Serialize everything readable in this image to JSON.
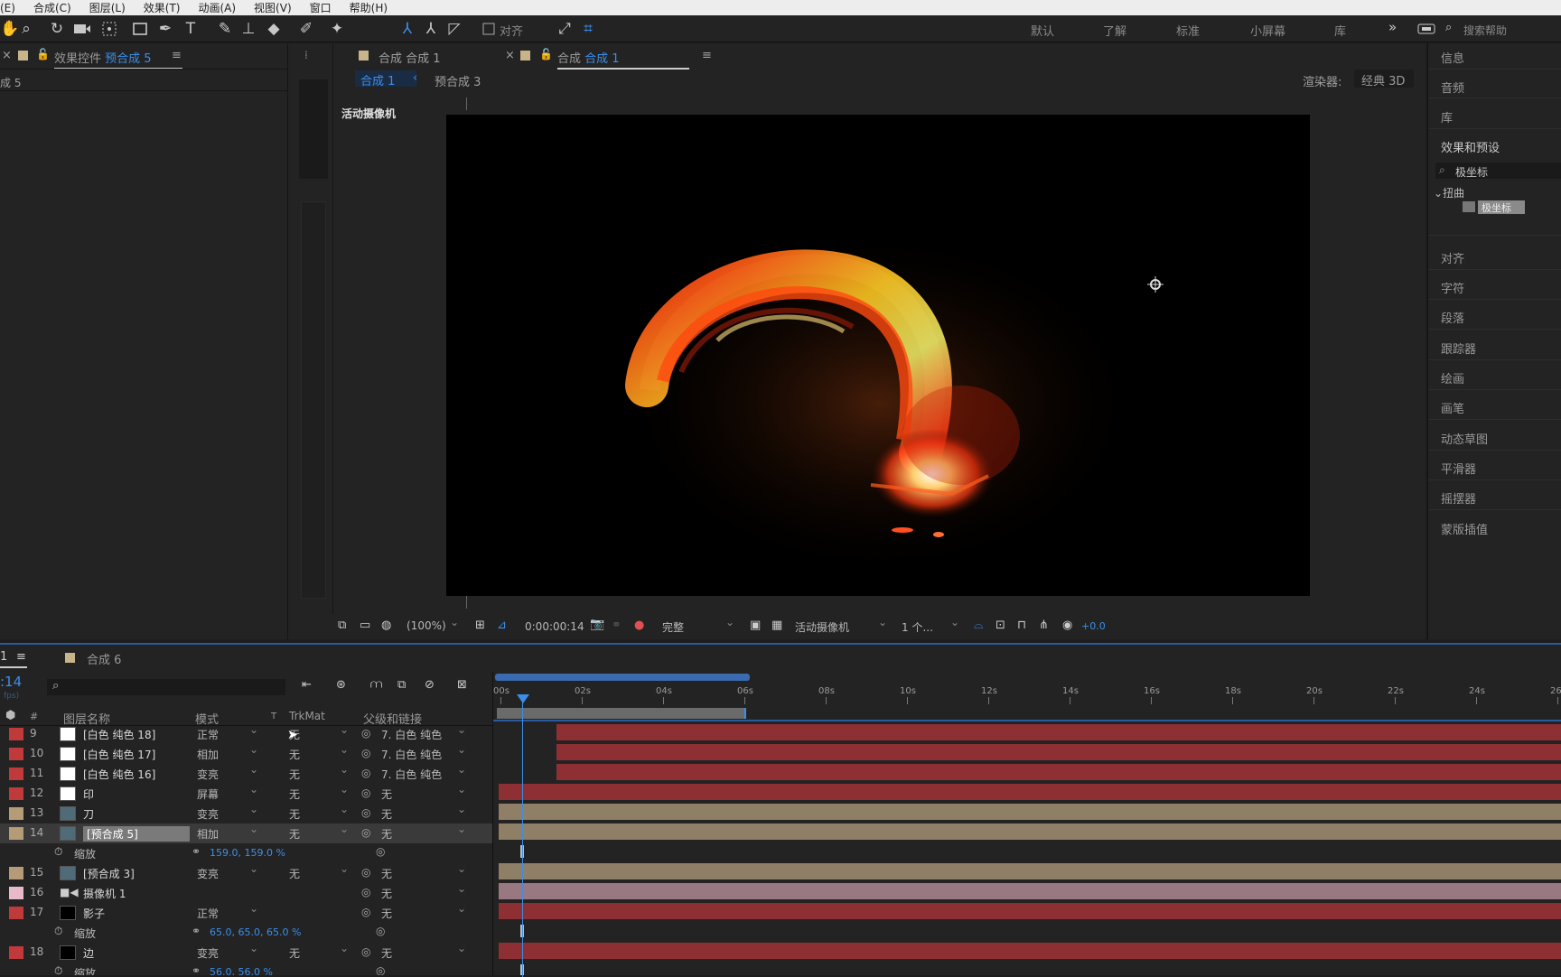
{
  "menu": [
    "(E)",
    "合成(C)",
    "图层(L)",
    "效果(T)",
    "动画(A)",
    "视图(V)",
    "窗口",
    "帮助(H)"
  ],
  "toolbar": {
    "align_label": "对齐"
  },
  "workspaces": [
    "默认",
    "了解",
    "标准",
    "小屏幕",
    "库"
  ],
  "search_help": {
    "placeholder": "搜索帮助"
  },
  "effects_panel": {
    "close": "×",
    "title": "效果控件",
    "comp": "预合成 5",
    "menu": "≡",
    "crumb": "成 5"
  },
  "viewer": {
    "tab_inactive": "合成 合成 1",
    "tab_active_prefix": "合成",
    "tab_active_comp": "合成 1",
    "crumb_active": "合成 1",
    "crumb_sep": "‹",
    "crumb_other": "预合成 3",
    "renderer_label": "渲染器:",
    "renderer_value": "经典 3D",
    "camera_label": "活动摄像机",
    "zoom": "(100%)",
    "timecode": "0:00:00:14",
    "quality": "完整",
    "view": "活动摄像机",
    "views_count": "1 个...",
    "exposure": "+0.0"
  },
  "right_panel": {
    "items_top": [
      "信息",
      "音频",
      "库",
      "效果和预设"
    ],
    "search_value": "极坐标",
    "group": "扭曲",
    "effect_item": "极坐标",
    "items_bottom": [
      "对齐",
      "字符",
      "段落",
      "跟踪器",
      "绘画",
      "画笔",
      "动态草图",
      "平滑器",
      "摇摆器",
      "蒙版插值"
    ]
  },
  "timeline": {
    "tab_num": "1",
    "tab_menu": "≡",
    "tab_other": "合成 6",
    "timecode": ":14",
    "fps": "fps)",
    "col_headers": {
      "label": "#",
      "name": "图层名称",
      "mode": "模式",
      "t": "T",
      "trkmat": "TrkMat",
      "parent": "父级和链接"
    },
    "ruler": [
      "00s",
      "02s",
      "04s",
      "06s",
      "08s",
      "10s",
      "12s",
      "14s",
      "16s",
      "18s",
      "20s",
      "22s",
      "24s",
      "26s"
    ],
    "rows": [
      {
        "type": "layer",
        "num": "9",
        "name": "[白色 纯色 18]",
        "mode": "正常",
        "trk": "无",
        "parent": "7. 白色 纯色",
        "color": "#c0393b",
        "thumb": "#ffffff"
      },
      {
        "type": "layer",
        "num": "10",
        "name": "[白色 纯色 17]",
        "mode": "相加",
        "trk": "无",
        "parent": "7. 白色 纯色",
        "color": "#c0393b",
        "thumb": "#ffffff"
      },
      {
        "type": "layer",
        "num": "11",
        "name": "[白色 纯色 16]",
        "mode": "变亮",
        "trk": "无",
        "parent": "7. 白色 纯色",
        "color": "#c0393b",
        "thumb": "#ffffff"
      },
      {
        "type": "layer",
        "num": "12",
        "name": "印",
        "mode": "屏幕",
        "trk": "无",
        "parent": "无",
        "color": "#c0393b",
        "thumb": "#ffffff"
      },
      {
        "type": "layer",
        "num": "13",
        "name": "刀",
        "mode": "变亮",
        "trk": "无",
        "parent": "无",
        "color": "#b69b78",
        "thumb": "#4f6b78"
      },
      {
        "type": "layer",
        "num": "14",
        "name": "[预合成 5]",
        "mode": "相加",
        "trk": "无",
        "parent": "无",
        "color": "#b69b78",
        "thumb": "#4f6b78",
        "selected": true
      },
      {
        "type": "prop",
        "name": "缩放",
        "value": "159.0, 159.0 %"
      },
      {
        "type": "layer",
        "num": "15",
        "name": "[预合成 3]",
        "mode": "变亮",
        "trk": "无",
        "parent": "无",
        "color": "#b69b78",
        "thumb": "#4f6b78"
      },
      {
        "type": "layer",
        "num": "16",
        "name": "摄像机 1",
        "mode": "",
        "trk": "",
        "parent": "无",
        "color": "#e8b9c8",
        "thumb": "camera"
      },
      {
        "type": "layer",
        "num": "17",
        "name": "影子",
        "mode": "正常",
        "trk": "",
        "parent": "无",
        "color": "#c0393b",
        "thumb": "#000000"
      },
      {
        "type": "prop",
        "name": "缩放",
        "value": "65.0, 65.0, 65.0 %"
      },
      {
        "type": "layer",
        "num": "18",
        "name": "边",
        "mode": "变亮",
        "trk": "无",
        "parent": "无",
        "color": "#c0393b",
        "thumb": "#000000"
      },
      {
        "type": "prop",
        "name": "缩放",
        "value": "56.0, 56.0 %"
      }
    ]
  }
}
